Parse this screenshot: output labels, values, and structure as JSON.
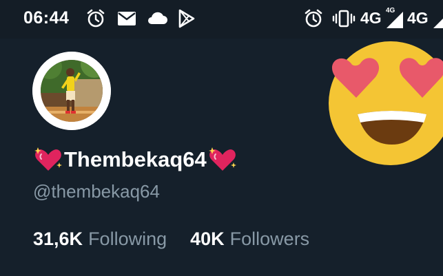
{
  "status_bar": {
    "time": "06:44",
    "left_icons": [
      "alarm-icon",
      "mail-icon",
      "cloud-icon",
      "play-store-icon"
    ],
    "right_icons": [
      "alarm-icon",
      "vibrate-icon",
      "signal-icon",
      "signal-icon"
    ],
    "network_1": "4G",
    "network_1_small": "4G",
    "network_2": "4G"
  },
  "profile": {
    "display_name": "Thembekaq64",
    "handle": "@thembekaq64",
    "name_decoration_icon": "sparkling-heart-icon",
    "overlay_emoji": "heart-eyes-emoji"
  },
  "stats": {
    "following_count": "31,6K",
    "following_label": "Following",
    "followers_count": "40K",
    "followers_label": "Followers"
  },
  "colors": {
    "background": "#15202b",
    "status_bar_background": "#141d26",
    "secondary_text": "#8899a6",
    "primary_text": "#ffffff"
  }
}
